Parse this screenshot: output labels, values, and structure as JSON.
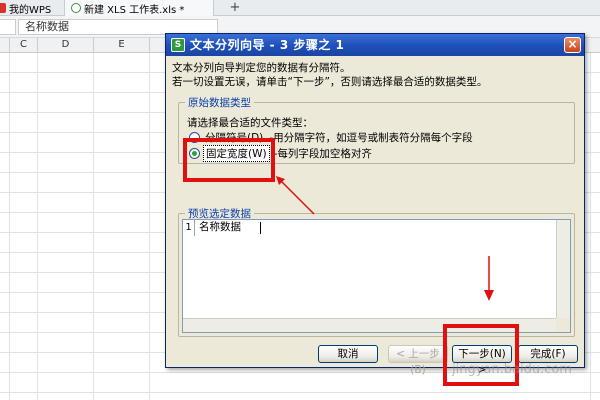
{
  "tabs": [
    {
      "label": "我的WPS"
    },
    {
      "label": "新建 XLS 工作表.xls *"
    }
  ],
  "tab_add": "+",
  "formula": {
    "content": "名称数据"
  },
  "columns": [
    "C",
    "D",
    "E"
  ],
  "dialog": {
    "title": "文本分列向导 - 3 步骤之 1",
    "close": "×",
    "app_icon": "S",
    "intro_line1": "文本分列向导判定您的数据有分隔符。",
    "intro_line2": "若一切设置无误，请单击“下一步”，否则请选择最合适的数据类型。",
    "group_original": {
      "label": "原始数据类型",
      "prompt": "请选择最合适的文件类型：",
      "options": [
        {
          "label": "分隔符号(D)",
          "desc": "-用分隔字符，如逗号或制表符分隔每个字段",
          "selected": false
        },
        {
          "label": "固定宽度(W)",
          "desc": "-每列字段加空格对齐",
          "selected": true
        }
      ]
    },
    "group_preview": {
      "label": "预览选定数据",
      "rows": [
        {
          "num": "1",
          "text": "名称数据"
        }
      ]
    },
    "buttons": {
      "cancel": "取消",
      "back": "< 上一步(B)",
      "next": "下一步(N) >",
      "finish": "完成(F)"
    }
  },
  "watermark": "jingyan.baidu.com",
  "colors": {
    "title_bar": "#1e4fb8",
    "dialog_bg": "#ece9d8",
    "annotation_red": "#e01010"
  }
}
